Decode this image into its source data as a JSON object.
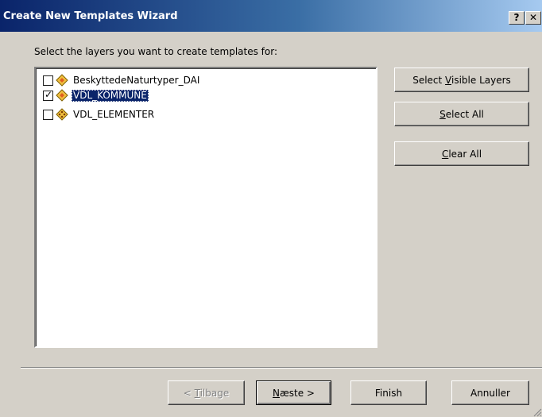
{
  "window": {
    "title": "Create New Templates Wizard",
    "help_label": "?",
    "close_label": "✕"
  },
  "prompt": "Select the layers you want to create templates for:",
  "layers": [
    {
      "name": "BeskyttedeNaturtyper_DAI",
      "checked": false,
      "selected": false,
      "icon": "polygon-layer-icon"
    },
    {
      "name": "VDL_KOMMUNE",
      "checked": true,
      "selected": true,
      "icon": "polygon-layer-icon"
    },
    {
      "name": "VDL_ELEMENTER",
      "checked": false,
      "selected": false,
      "icon": "point-layer-icon"
    }
  ],
  "side_buttons": {
    "select_visible_pre": "Select ",
    "select_visible_key": "V",
    "select_visible_post": "isible Layers",
    "select_all_key": "S",
    "select_all_post": "elect All",
    "clear_all_key": "C",
    "clear_all_post": "lear All"
  },
  "footer_buttons": {
    "back_pre": "< ",
    "back_key": "T",
    "back_post": "ilbage",
    "next_key": "N",
    "next_post": "æste >",
    "finish": "Finish",
    "cancel": "Annuller"
  },
  "colors": {
    "title_gradient_start": "#0a246a",
    "title_gradient_end": "#a6caf0",
    "dialog_bg": "#d4d0c8",
    "selection": "#0a246a"
  }
}
